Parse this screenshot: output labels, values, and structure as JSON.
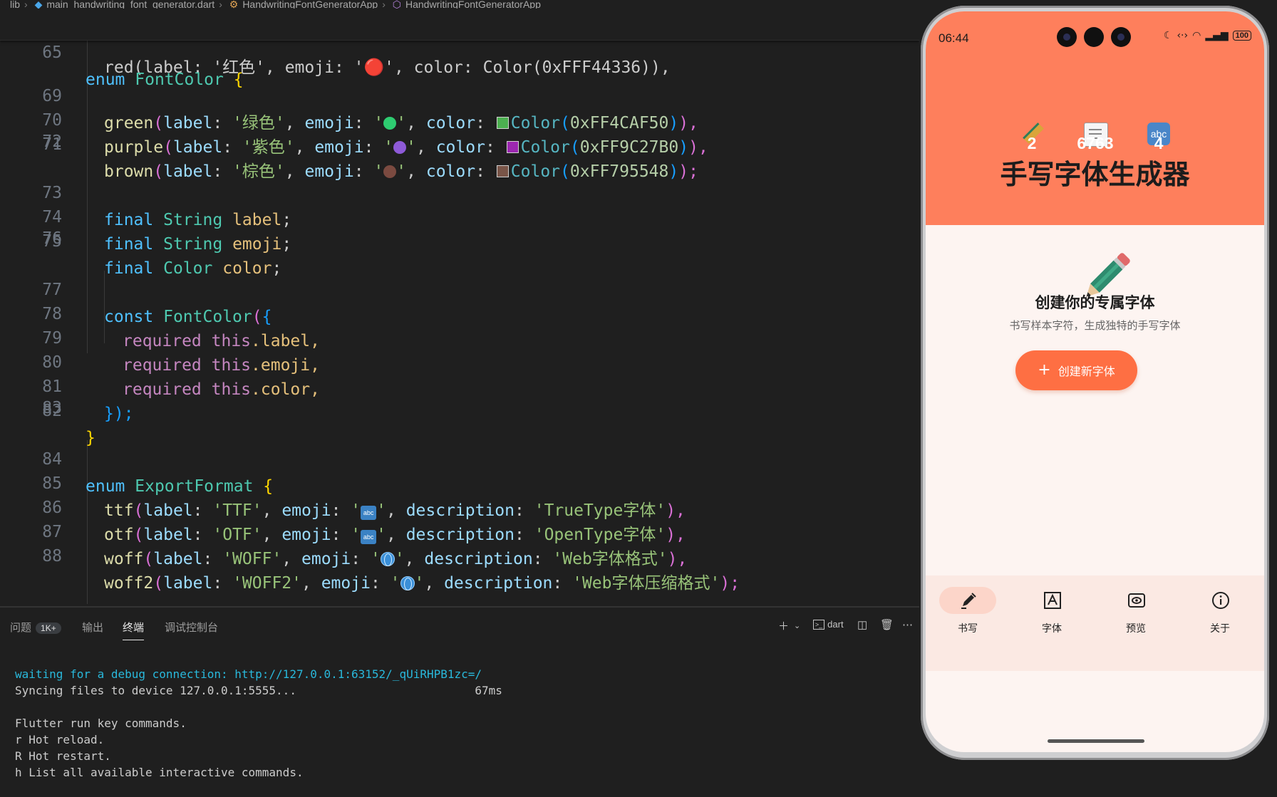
{
  "breadcrumb": [
    "lib",
    "main_handwriting_font_generator.dart",
    "HandwritingFontGeneratorApp",
    "HandwritingFontGeneratorApp"
  ],
  "editor": {
    "sticky": {
      "num": "65",
      "kw": "enum",
      "name": "FontColor",
      "brace": "{"
    },
    "line68_fragment": "red(label: '红色', emoji: '🔴', color: Color(0xFFF44336)),",
    "lines": [
      {
        "num": "69",
        "name": "green",
        "label": "'绿色'",
        "color": "0xFF4CAF50",
        "swatch": "#4CAF50",
        "end": "),"
      },
      {
        "num": "70",
        "name": "purple",
        "label": "'紫色'",
        "color": "0xFF9C27B0",
        "swatch": "#9C27B0",
        "end": "),"
      },
      {
        "num": "71",
        "name": "brown",
        "label": "'棕色'",
        "color": "0xFF795548",
        "swatch": "#795548",
        "end": ");"
      },
      {
        "num": "72"
      },
      {
        "num": "73",
        "field_type": "String",
        "field": "label"
      },
      {
        "num": "74",
        "field_type": "String",
        "field": "emoji"
      },
      {
        "num": "75",
        "field_type": "Color",
        "field": "color"
      },
      {
        "num": "76"
      },
      {
        "num": "77",
        "const": "const",
        "ctor": "FontColor"
      },
      {
        "num": "78",
        "req": "required",
        "this": "this",
        "field": ".label,"
      },
      {
        "num": "79",
        "req": "required",
        "this": "this",
        "field": ".emoji,"
      },
      {
        "num": "80",
        "req": "required",
        "this": "this",
        "field": ".color,"
      },
      {
        "num": "81",
        "close": "});"
      },
      {
        "num": "82",
        "close": "}"
      },
      {
        "num": "83"
      },
      {
        "num": "84",
        "kw": "enum",
        "name": "ExportFormat",
        "brace": "{"
      },
      {
        "num": "85",
        "name": "ttf",
        "label": "'TTF'",
        "desc": "'TrueType字体'",
        "end": "),"
      },
      {
        "num": "86",
        "name": "otf",
        "label": "'OTF'",
        "desc": "'OpenType字体'",
        "end": "),"
      },
      {
        "num": "87",
        "name": "woff",
        "label": "'WOFF'",
        "desc": "'Web字体格式'",
        "end": "),"
      },
      {
        "num": "88",
        "name": "woff2",
        "label": "'WOFF2'",
        "desc": "'Web字体压缩格式'",
        "end": ");"
      }
    ],
    "tokens": {
      "label_key": "label",
      "emoji_key": "emoji",
      "color_key": "color",
      "desc_key": "description",
      "color_ctor": "Color",
      "final": "final",
      "colon": ": ",
      "comma": ", "
    }
  },
  "panel": {
    "tabs": [
      {
        "label": "问题",
        "badge": "1K+"
      },
      {
        "label": "输出"
      },
      {
        "label": "终端",
        "active": true
      },
      {
        "label": "调试控制台"
      }
    ],
    "terminal_profile": "dart",
    "terminal_lines": [
      {
        "text": "waiting for a debug connection: http://127.0.0.1:63152/_qUiRHPB1zc=/",
        "cyan": true
      },
      {
        "text": "Syncing files to device 127.0.0.1:5555...                          67ms"
      },
      {
        "text": ""
      },
      {
        "text": "Flutter run key commands."
      },
      {
        "text": "r Hot reload."
      },
      {
        "text": "R Hot restart."
      },
      {
        "text": "h List all available interactive commands."
      }
    ]
  },
  "phone": {
    "time": "06:44",
    "battery": "100",
    "stats": [
      {
        "value": "2",
        "icon": "pencil-icon"
      },
      {
        "value": "6763",
        "icon": "memo-icon"
      },
      {
        "value": "4",
        "icon": "abc-icon",
        "icon_text": "abc"
      }
    ],
    "app_title": "手写字体生成器",
    "main_heading": "创建你的专属字体",
    "main_sub": "书写样本字符，生成独特的手写字体",
    "create_button": {
      "icon": "+",
      "label": "创建新字体"
    },
    "nav": [
      {
        "label": "书写",
        "icon": "write-icon",
        "active": true
      },
      {
        "label": "字体",
        "icon": "font-icon"
      },
      {
        "label": "预览",
        "icon": "preview-icon"
      },
      {
        "label": "关于",
        "icon": "info-icon"
      }
    ],
    "colors": {
      "header": "#fe7f5c",
      "button": "#fe6f43",
      "nav_bg": "#fbe9e3",
      "nav_active": "#fcd5c9",
      "body": "#fdf4f1"
    }
  }
}
